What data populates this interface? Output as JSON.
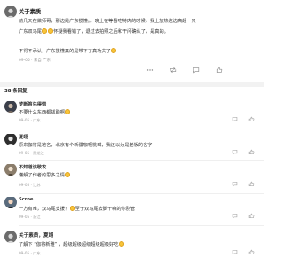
{
  "post": {
    "author": "关于素质",
    "lines": [
      "前几天在做师哥，那边是广东揽懂。",
      "晚上在等看吃特肉的时候，我上放热这边高超一只广东双马尾",
      "怀疑我看错了，退过去拍照之后和干问确认了，是真的。",
      "不得不承认，广东揽懂真的是带下了真功夫了"
    ],
    "date": "09-05",
    "location": "来自 广东"
  },
  "comments_count": "38 条回复",
  "comments": [
    {
      "name": "梦断笛先得惜",
      "text": "不要什么东西都拔助啊",
      "date": "09-05",
      "location": "广东"
    },
    {
      "name": "夏翊",
      "text": "原来伽将是地名，北京有个新疆咖喱桃琪，我还以为是老板的名字",
      "date": "09-05",
      "location": "黑龙江"
    },
    {
      "name": "不知道该歇攻",
      "text": "懂解了作者的思多之情",
      "date": "09-05",
      "location": "江苏"
    },
    {
      "name": "Scroe",
      "text": "一方有难，双马尾支援！",
      "text2": "至于双马尾去脚干嘛的你别管",
      "date": "09-05",
      "location": "浙江"
    }
  ],
  "reply": {
    "name": "关于素质，夏翊",
    "text": "了解下 “伽将新雅” ，超级超级超级超级超级好吃",
    "date": "09-05",
    "location": "广东"
  },
  "icons": [
    "more-icon",
    "repost-icon",
    "comment-icon",
    "like-icon"
  ],
  "colors": {
    "divider": "#f2f2f2",
    "meta": "#9a9a9a",
    "text": "#333333"
  }
}
